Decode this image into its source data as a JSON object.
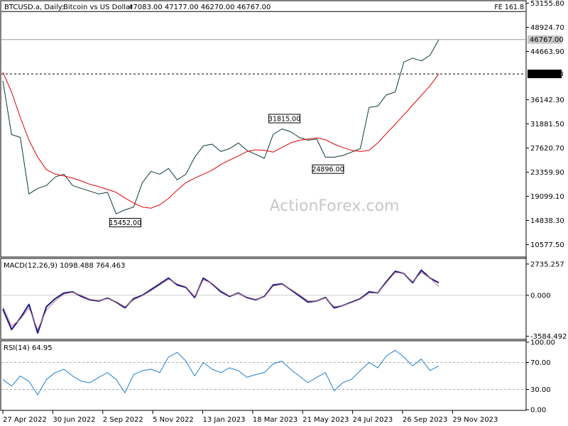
{
  "chart_data": [
    {
      "type": "line",
      "panel": "price",
      "header": {
        "symbol": "BTCUSD.a, Daily:",
        "description": "Bitcoin vs US Dollar",
        "ohlc": "47083.00 47177.00 46270.00 46767.00"
      },
      "watermark": "ActionForex.com",
      "ylim": [
        8500,
        53500
      ],
      "y_ticks": [
        {
          "value": 53155.8,
          "label": "53155.80"
        },
        {
          "value": 48924.7,
          "label": "48924.70"
        },
        {
          "value": 44663.9,
          "label": "44663.90"
        },
        {
          "value": 36142.3,
          "label": "36142.30"
        },
        {
          "value": 31881.5,
          "label": "31881.50"
        },
        {
          "value": 27620.7,
          "label": "27620.70"
        },
        {
          "value": 23359.9,
          "label": "23359.90"
        },
        {
          "value": 19099.1,
          "label": "19099.10"
        },
        {
          "value": 14838.3,
          "label": "14838.30"
        },
        {
          "value": 10577.5,
          "label": "10577.50"
        }
      ],
      "x_ticks": [
        "27 Apr 2022",
        "30 Jun 2022",
        "2 Sep 2022",
        "5 Nov 2022",
        "13 Jan 2023",
        "18 Mar 2023",
        "21 May 2023",
        "24 Jul 2023",
        "26 Sep 2023",
        "29 Nov 2023"
      ],
      "levels": [
        {
          "value": 51720,
          "label": "FE 161.8",
          "style": "solid"
        },
        {
          "value": 46767,
          "label": "46767.00",
          "style": "solid-gray"
        },
        {
          "value": 40701,
          "label": "40701.00",
          "style": "dashed"
        }
      ],
      "annotations": [
        {
          "label": "15452.00",
          "value": 15452,
          "x_frac": 0.32
        },
        {
          "label": "31815.00",
          "value": 31815,
          "x_frac": 0.685
        },
        {
          "label": "24896.00",
          "value": 24896,
          "x_frac": 0.785
        }
      ],
      "series": [
        {
          "role": "price",
          "color": "#0b3a3a",
          "x_frac": [
            0,
            0.02,
            0.04,
            0.06,
            0.08,
            0.1,
            0.12,
            0.14,
            0.16,
            0.18,
            0.2,
            0.22,
            0.24,
            0.26,
            0.28,
            0.3,
            0.32,
            0.34,
            0.36,
            0.38,
            0.4,
            0.42,
            0.44,
            0.46,
            0.48,
            0.5,
            0.52,
            0.54,
            0.56,
            0.58,
            0.6,
            0.62,
            0.64,
            0.66,
            0.68,
            0.7,
            0.72,
            0.74,
            0.76,
            0.78,
            0.8,
            0.82,
            0.84,
            0.86,
            0.88,
            0.9,
            0.92,
            0.94,
            0.96,
            0.98,
            1.0
          ],
          "values": [
            39500,
            30000,
            29500,
            19500,
            20500,
            21000,
            22500,
            23000,
            21000,
            20500,
            20000,
            19500,
            19800,
            16000,
            16700,
            17200,
            21500,
            23500,
            23000,
            24000,
            22000,
            23000,
            26000,
            28000,
            28300,
            27000,
            27500,
            28500,
            27200,
            26500,
            25800,
            30000,
            31000,
            30500,
            29500,
            29000,
            29200,
            26000,
            26000,
            26300,
            26900,
            27500,
            34800,
            35000,
            37000,
            37500,
            42800,
            43500,
            43000,
            44000,
            46767
          ]
        },
        {
          "role": "moving-average",
          "color": "#e00000",
          "x_frac": [
            0,
            0.02,
            0.04,
            0.06,
            0.08,
            0.1,
            0.12,
            0.14,
            0.16,
            0.18,
            0.2,
            0.22,
            0.24,
            0.26,
            0.28,
            0.3,
            0.32,
            0.34,
            0.36,
            0.38,
            0.4,
            0.42,
            0.44,
            0.46,
            0.48,
            0.5,
            0.52,
            0.54,
            0.56,
            0.58,
            0.6,
            0.62,
            0.64,
            0.66,
            0.68,
            0.7,
            0.72,
            0.74,
            0.76,
            0.78,
            0.8,
            0.82,
            0.84,
            0.86,
            0.88,
            0.9,
            0.92,
            0.94,
            0.96,
            0.98,
            1.0
          ],
          "values": [
            41000,
            37500,
            33000,
            29000,
            26000,
            23800,
            23000,
            22700,
            22300,
            21800,
            21200,
            20800,
            20300,
            19800,
            18800,
            17900,
            17200,
            17000,
            17600,
            18700,
            20200,
            21500,
            22300,
            23000,
            23700,
            24700,
            25500,
            26200,
            27000,
            27300,
            27200,
            26900,
            27700,
            28500,
            29000,
            29200,
            29400,
            29100,
            28300,
            27700,
            27200,
            27000,
            27200,
            28500,
            30200,
            31800,
            33500,
            35200,
            36900,
            38600,
            40701
          ]
        }
      ]
    },
    {
      "type": "line",
      "panel": "macd",
      "label": "MACD(12,26,9) 1098.488 764.463",
      "ylim": [
        -3800,
        3100
      ],
      "y_ticks": [
        {
          "value": 2735.257,
          "label": "2735.257"
        },
        {
          "value": 0,
          "label": "0.000"
        },
        {
          "value": -3584.492,
          "label": "-3584.492"
        }
      ],
      "series": [
        {
          "role": "macd",
          "color": "#1a1a8c",
          "x_frac": [
            0,
            0.02,
            0.04,
            0.06,
            0.08,
            0.1,
            0.12,
            0.14,
            0.16,
            0.18,
            0.2,
            0.22,
            0.24,
            0.26,
            0.28,
            0.3,
            0.32,
            0.34,
            0.36,
            0.38,
            0.4,
            0.42,
            0.44,
            0.46,
            0.48,
            0.5,
            0.52,
            0.54,
            0.56,
            0.58,
            0.6,
            0.62,
            0.64,
            0.66,
            0.68,
            0.7,
            0.72,
            0.74,
            0.76,
            0.78,
            0.8,
            0.82,
            0.84,
            0.86,
            0.88,
            0.9,
            0.92,
            0.94,
            0.96,
            0.98,
            1.0
          ],
          "values": [
            -1200,
            -3000,
            -2000,
            -800,
            -3300,
            -1000,
            -300,
            200,
            300,
            -100,
            -400,
            -500,
            -250,
            -600,
            -1100,
            -300,
            0,
            500,
            1000,
            1500,
            900,
            700,
            -200,
            1500,
            1000,
            300,
            -100,
            200,
            -200,
            -400,
            -100,
            900,
            1000,
            500,
            -50,
            -600,
            -500,
            -200,
            -1100,
            -900,
            -600,
            -300,
            300,
            200,
            1200,
            2100,
            1900,
            1100,
            2200,
            1500,
            1098
          ]
        },
        {
          "role": "signal",
          "color": "#c08080",
          "x_frac": [
            0,
            0.02,
            0.04,
            0.06,
            0.08,
            0.1,
            0.12,
            0.14,
            0.16,
            0.18,
            0.2,
            0.22,
            0.24,
            0.26,
            0.28,
            0.3,
            0.32,
            0.34,
            0.36,
            0.38,
            0.4,
            0.42,
            0.44,
            0.46,
            0.48,
            0.5,
            0.52,
            0.54,
            0.56,
            0.58,
            0.6,
            0.62,
            0.64,
            0.66,
            0.68,
            0.7,
            0.72,
            0.74,
            0.76,
            0.78,
            0.8,
            0.82,
            0.84,
            0.86,
            0.88,
            0.9,
            0.92,
            0.94,
            0.96,
            0.98,
            1.0
          ],
          "values": [
            -1000,
            -2700,
            -2100,
            -1100,
            -3000,
            -1300,
            -500,
            100,
            250,
            0,
            -350,
            -450,
            -300,
            -550,
            -1000,
            -400,
            -50,
            400,
            900,
            1400,
            1000,
            750,
            -100,
            1350,
            1050,
            400,
            -50,
            150,
            -150,
            -350,
            -150,
            800,
            950,
            550,
            50,
            -500,
            -500,
            -250,
            -1000,
            -900,
            -650,
            -350,
            200,
            200,
            1100,
            2000,
            1900,
            1200,
            2000,
            1500,
            764
          ]
        }
      ]
    },
    {
      "type": "line",
      "panel": "rsi",
      "label": "RSI(14) 64.95",
      "ylim": [
        0,
        100
      ],
      "y_ticks": [
        {
          "value": 100,
          "label": "100.00"
        },
        {
          "value": 70,
          "label": "70.00"
        },
        {
          "value": 30,
          "label": "30.00"
        },
        {
          "value": 0,
          "label": "0.00"
        }
      ],
      "levels": [
        70,
        30
      ],
      "series": [
        {
          "role": "rsi",
          "color": "#1e7fd0",
          "x_frac": [
            0,
            0.02,
            0.04,
            0.06,
            0.08,
            0.1,
            0.12,
            0.14,
            0.16,
            0.18,
            0.2,
            0.22,
            0.24,
            0.26,
            0.28,
            0.3,
            0.32,
            0.34,
            0.36,
            0.38,
            0.4,
            0.42,
            0.44,
            0.46,
            0.48,
            0.5,
            0.52,
            0.54,
            0.56,
            0.58,
            0.6,
            0.62,
            0.64,
            0.66,
            0.68,
            0.7,
            0.72,
            0.74,
            0.76,
            0.78,
            0.8,
            0.82,
            0.84,
            0.86,
            0.88,
            0.9,
            0.92,
            0.94,
            0.96,
            0.98,
            1.0
          ],
          "values": [
            45,
            35,
            50,
            42,
            22,
            45,
            55,
            60,
            50,
            42,
            40,
            48,
            55,
            45,
            25,
            52,
            58,
            60,
            55,
            78,
            85,
            72,
            50,
            70,
            60,
            55,
            62,
            58,
            48,
            52,
            55,
            68,
            72,
            60,
            50,
            40,
            48,
            55,
            28,
            40,
            45,
            58,
            70,
            62,
            80,
            88,
            78,
            65,
            75,
            58,
            65
          ]
        }
      ]
    }
  ]
}
